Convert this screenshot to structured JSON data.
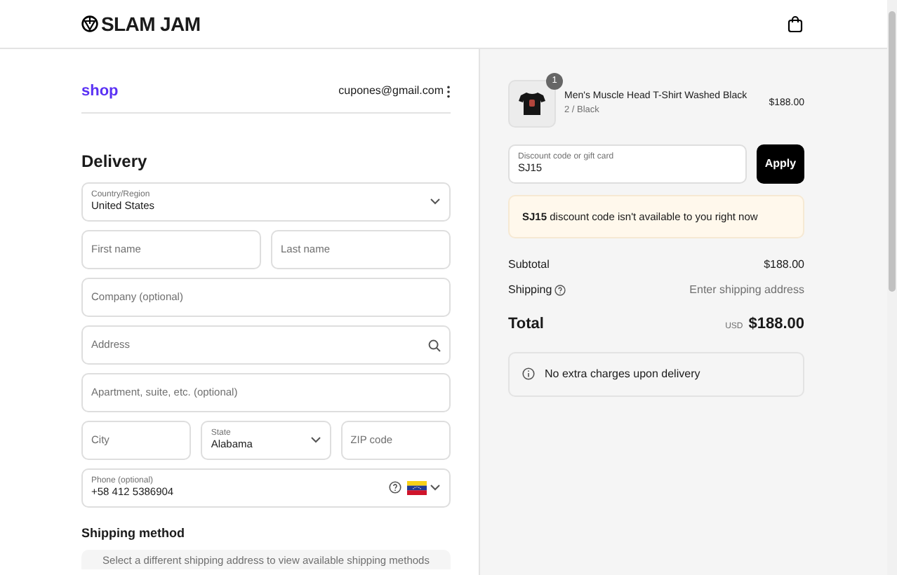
{
  "header": {
    "logo": "SLAM JAM"
  },
  "account": {
    "brand": "shop",
    "email": "cupones@gmail.com"
  },
  "delivery": {
    "title": "Delivery",
    "rows": [
      [
        {
          "kind": "select",
          "label": "Country/Region",
          "value": "United States"
        }
      ],
      [
        {
          "kind": "text",
          "placeholder": "First name"
        },
        {
          "kind": "text",
          "placeholder": "Last name"
        }
      ],
      [
        {
          "kind": "text",
          "placeholder": "Company (optional)"
        }
      ],
      [
        {
          "kind": "search",
          "placeholder": "Address"
        }
      ],
      [
        {
          "kind": "text",
          "placeholder": "Apartment, suite, etc. (optional)"
        }
      ],
      [
        {
          "kind": "text",
          "placeholder": "City"
        },
        {
          "kind": "select",
          "label": "State",
          "value": "Alabama"
        },
        {
          "kind": "text",
          "placeholder": "ZIP code"
        }
      ],
      [
        {
          "kind": "phone",
          "label": "Phone (optional)",
          "value": "+58 412 5386904"
        }
      ]
    ]
  },
  "shipping_method": {
    "title": "Shipping method",
    "notice": "Select a different shipping address to view available shipping methods"
  },
  "summary": {
    "item": {
      "quantity": "1",
      "name": "Men's Muscle Head T-Shirt Washed Black",
      "variant": "2 / Black",
      "price": "$188.00"
    },
    "discount": {
      "label": "Discount code or gift card",
      "value": "SJ15",
      "button": "Apply"
    },
    "alert": "**SJ15** discount code isn't available to you right now",
    "lines": [
      {
        "kind": "plain",
        "label": "Subtotal",
        "value": "$188.00"
      },
      {
        "kind": "help",
        "label": "Shipping",
        "value": "Enter shipping address"
      }
    ],
    "total": {
      "label": "Total",
      "currency": "USD",
      "amount": "$188.00"
    },
    "info": "No extra charges upon delivery"
  }
}
